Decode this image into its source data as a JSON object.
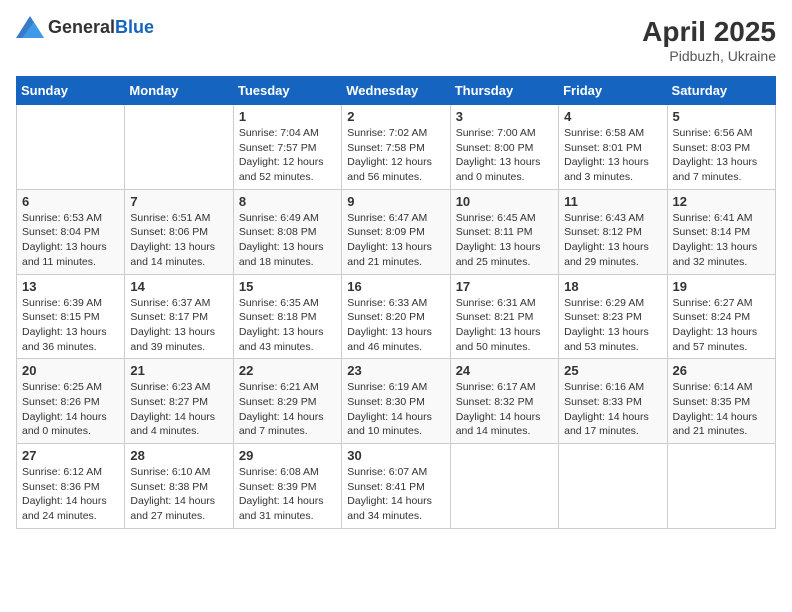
{
  "logo": {
    "general": "General",
    "blue": "Blue"
  },
  "title": {
    "month_year": "April 2025",
    "location": "Pidbuzh, Ukraine"
  },
  "weekdays": [
    "Sunday",
    "Monday",
    "Tuesday",
    "Wednesday",
    "Thursday",
    "Friday",
    "Saturday"
  ],
  "weeks": [
    [
      {
        "day": "",
        "info": ""
      },
      {
        "day": "",
        "info": ""
      },
      {
        "day": "1",
        "info": "Sunrise: 7:04 AM\nSunset: 7:57 PM\nDaylight: 12 hours and 52 minutes."
      },
      {
        "day": "2",
        "info": "Sunrise: 7:02 AM\nSunset: 7:58 PM\nDaylight: 12 hours and 56 minutes."
      },
      {
        "day": "3",
        "info": "Sunrise: 7:00 AM\nSunset: 8:00 PM\nDaylight: 13 hours and 0 minutes."
      },
      {
        "day": "4",
        "info": "Sunrise: 6:58 AM\nSunset: 8:01 PM\nDaylight: 13 hours and 3 minutes."
      },
      {
        "day": "5",
        "info": "Sunrise: 6:56 AM\nSunset: 8:03 PM\nDaylight: 13 hours and 7 minutes."
      }
    ],
    [
      {
        "day": "6",
        "info": "Sunrise: 6:53 AM\nSunset: 8:04 PM\nDaylight: 13 hours and 11 minutes."
      },
      {
        "day": "7",
        "info": "Sunrise: 6:51 AM\nSunset: 8:06 PM\nDaylight: 13 hours and 14 minutes."
      },
      {
        "day": "8",
        "info": "Sunrise: 6:49 AM\nSunset: 8:08 PM\nDaylight: 13 hours and 18 minutes."
      },
      {
        "day": "9",
        "info": "Sunrise: 6:47 AM\nSunset: 8:09 PM\nDaylight: 13 hours and 21 minutes."
      },
      {
        "day": "10",
        "info": "Sunrise: 6:45 AM\nSunset: 8:11 PM\nDaylight: 13 hours and 25 minutes."
      },
      {
        "day": "11",
        "info": "Sunrise: 6:43 AM\nSunset: 8:12 PM\nDaylight: 13 hours and 29 minutes."
      },
      {
        "day": "12",
        "info": "Sunrise: 6:41 AM\nSunset: 8:14 PM\nDaylight: 13 hours and 32 minutes."
      }
    ],
    [
      {
        "day": "13",
        "info": "Sunrise: 6:39 AM\nSunset: 8:15 PM\nDaylight: 13 hours and 36 minutes."
      },
      {
        "day": "14",
        "info": "Sunrise: 6:37 AM\nSunset: 8:17 PM\nDaylight: 13 hours and 39 minutes."
      },
      {
        "day": "15",
        "info": "Sunrise: 6:35 AM\nSunset: 8:18 PM\nDaylight: 13 hours and 43 minutes."
      },
      {
        "day": "16",
        "info": "Sunrise: 6:33 AM\nSunset: 8:20 PM\nDaylight: 13 hours and 46 minutes."
      },
      {
        "day": "17",
        "info": "Sunrise: 6:31 AM\nSunset: 8:21 PM\nDaylight: 13 hours and 50 minutes."
      },
      {
        "day": "18",
        "info": "Sunrise: 6:29 AM\nSunset: 8:23 PM\nDaylight: 13 hours and 53 minutes."
      },
      {
        "day": "19",
        "info": "Sunrise: 6:27 AM\nSunset: 8:24 PM\nDaylight: 13 hours and 57 minutes."
      }
    ],
    [
      {
        "day": "20",
        "info": "Sunrise: 6:25 AM\nSunset: 8:26 PM\nDaylight: 14 hours and 0 minutes."
      },
      {
        "day": "21",
        "info": "Sunrise: 6:23 AM\nSunset: 8:27 PM\nDaylight: 14 hours and 4 minutes."
      },
      {
        "day": "22",
        "info": "Sunrise: 6:21 AM\nSunset: 8:29 PM\nDaylight: 14 hours and 7 minutes."
      },
      {
        "day": "23",
        "info": "Sunrise: 6:19 AM\nSunset: 8:30 PM\nDaylight: 14 hours and 10 minutes."
      },
      {
        "day": "24",
        "info": "Sunrise: 6:17 AM\nSunset: 8:32 PM\nDaylight: 14 hours and 14 minutes."
      },
      {
        "day": "25",
        "info": "Sunrise: 6:16 AM\nSunset: 8:33 PM\nDaylight: 14 hours and 17 minutes."
      },
      {
        "day": "26",
        "info": "Sunrise: 6:14 AM\nSunset: 8:35 PM\nDaylight: 14 hours and 21 minutes."
      }
    ],
    [
      {
        "day": "27",
        "info": "Sunrise: 6:12 AM\nSunset: 8:36 PM\nDaylight: 14 hours and 24 minutes."
      },
      {
        "day": "28",
        "info": "Sunrise: 6:10 AM\nSunset: 8:38 PM\nDaylight: 14 hours and 27 minutes."
      },
      {
        "day": "29",
        "info": "Sunrise: 6:08 AM\nSunset: 8:39 PM\nDaylight: 14 hours and 31 minutes."
      },
      {
        "day": "30",
        "info": "Sunrise: 6:07 AM\nSunset: 8:41 PM\nDaylight: 14 hours and 34 minutes."
      },
      {
        "day": "",
        "info": ""
      },
      {
        "day": "",
        "info": ""
      },
      {
        "day": "",
        "info": ""
      }
    ]
  ]
}
